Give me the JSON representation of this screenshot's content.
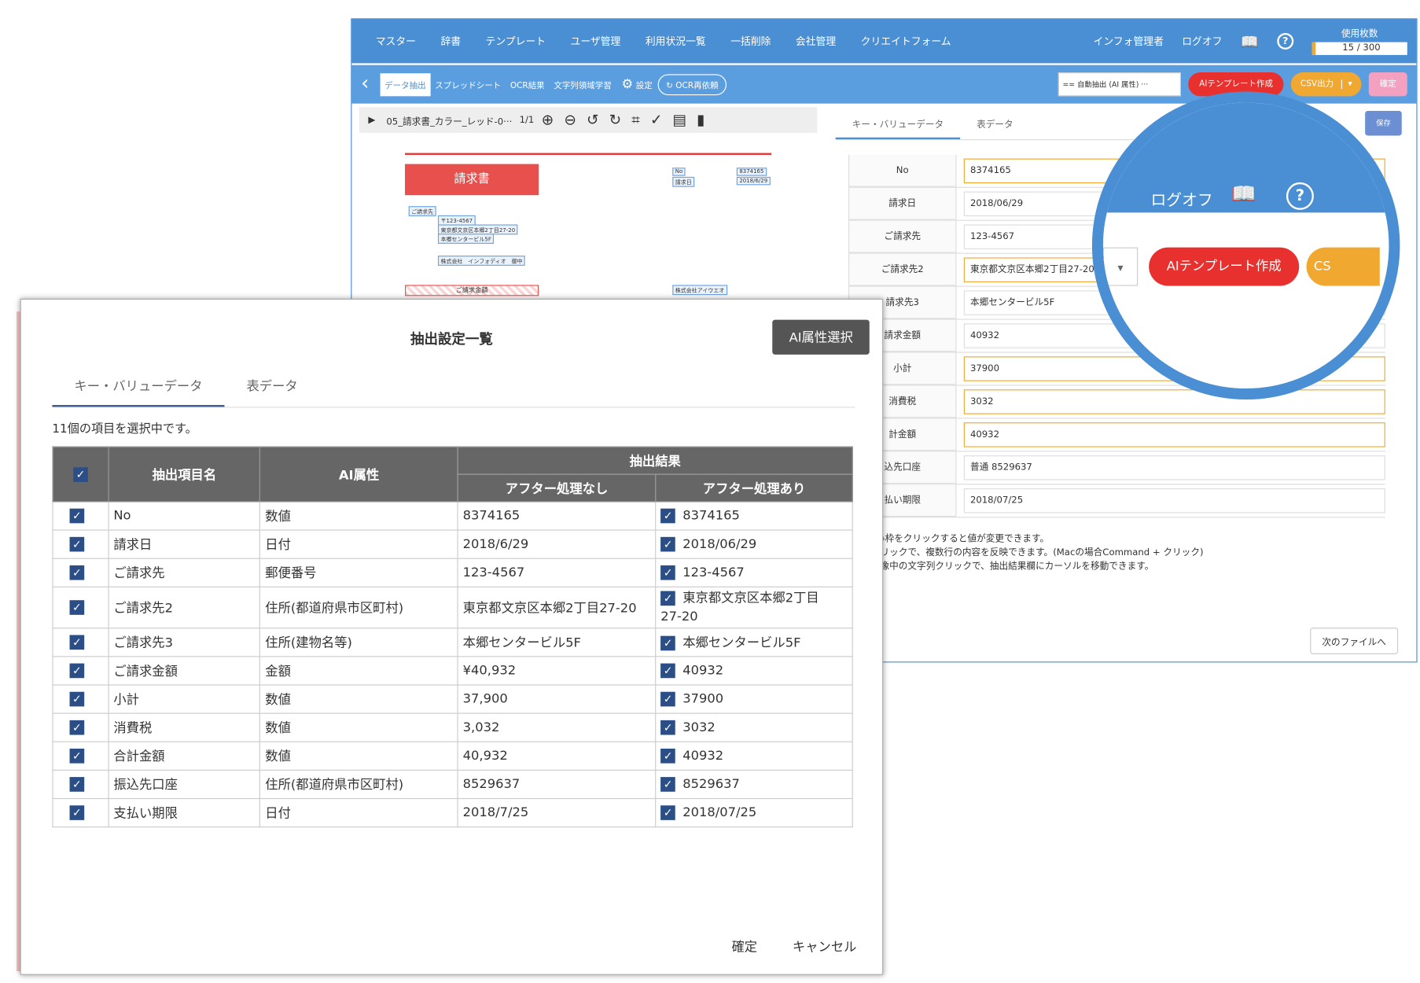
{
  "topnav": {
    "menu": [
      "マスター",
      "辞書",
      "テンプレート",
      "ユーザ管理",
      "利用状況一覧",
      "一括削除",
      "会社管理",
      "クリエイトフォーム"
    ],
    "user": "インフォ管理者",
    "logoff": "ログオフ",
    "usage_label": "使用枚数",
    "usage_value": "15 / 300"
  },
  "toolbar": {
    "tabs": [
      "データ抽出",
      "スプレッドシート",
      "OCR結果",
      "文字列領域学習"
    ],
    "settings": "設定",
    "ocr_retry": "OCR再依頼",
    "extract_select": "== 自動抽出 (AI 属性) ···",
    "ai_template": "AIテンプレート作成",
    "csv_output": "CSV出力",
    "confirm": "確定"
  },
  "document": {
    "filename": "05_請求書_カラー_レッド-0···",
    "page": "1/1",
    "pdf_title": "請求書",
    "pdf_labels": {
      "no_key": "No",
      "no_val": "8374165",
      "date_key": "請求日",
      "date_val": "2018/6/29",
      "bill_to": "ご請求先",
      "zip": "〒123-4567",
      "address": "東京都文京区本郷2丁目27-20",
      "building": "本郷センタービル5F",
      "company": "株式会社　インフォディオ　御中",
      "amount_label": "ご請求金額",
      "issuer": "株式会社アイウエオ"
    }
  },
  "right_panel": {
    "tabs": [
      "キー・バリューデータ",
      "表データ"
    ],
    "save": "保存",
    "rows": [
      {
        "key": "No",
        "value": "8374165"
      },
      {
        "key": "請求日",
        "value": "2018/06/29"
      },
      {
        "key": "ご請求先",
        "value": "123-4567"
      },
      {
        "key": "ご請求先2",
        "value": "東京都文京区本郷2丁目27-20"
      },
      {
        "key": "請求先3",
        "value": "本郷センタービル5F"
      },
      {
        "key": "請求金額",
        "value": "40932"
      },
      {
        "key": "小計",
        "value": "37900"
      },
      {
        "key": "消費税",
        "value": "3032"
      },
      {
        "key": "計金額",
        "value": "40932"
      },
      {
        "key": "込先口座",
        "value": "普通 8529637"
      },
      {
        "key": "払い期限",
        "value": "2018/07/25"
      }
    ],
    "notes": [
      "この青い枠をクリックすると値が変更できます。",
      "ー + クリックで、複数行の内容を反映できます。(Macの場合Command + クリック)",
      "ー + 画像中の文字列クリックで、抽出結果欄にカーソルを移動できます。"
    ],
    "next_file": "次のファイルへ"
  },
  "magnifier": {
    "logoff": "ログオフ",
    "ai_template": "AIテンプレート作成",
    "csv_partial": "CS"
  },
  "modal": {
    "title": "抽出設定一覧",
    "ai_attr_button": "AI属性選択",
    "tabs": [
      "キー・バリューデータ",
      "表データ"
    ],
    "selection_count": "11個の項目を選択中です。",
    "headers": {
      "item_name": "抽出項目名",
      "ai_attr": "AI属性",
      "result": "抽出結果",
      "after_none": "アフター処理なし",
      "after_yes": "アフター処理あり"
    },
    "rows": [
      {
        "name": "No",
        "attr": "数値",
        "raw": "8374165",
        "processed": "8374165"
      },
      {
        "name": "請求日",
        "attr": "日付",
        "raw": "2018/6/29",
        "processed": "2018/06/29"
      },
      {
        "name": "ご請求先",
        "attr": "郵便番号",
        "raw": "123-4567",
        "processed": "123-4567"
      },
      {
        "name": "ご請求先2",
        "attr": "住所(都道府県市区町村)",
        "raw": "東京都文京区本郷2丁目27-20",
        "processed": "東京都文京区本郷2丁目",
        "processed2": "27-20"
      },
      {
        "name": "ご請求先3",
        "attr": "住所(建物名等)",
        "raw": "本郷センタービル5F",
        "processed": "本郷センタービル5F"
      },
      {
        "name": "ご請求金額",
        "attr": "金額",
        "raw": "¥40,932",
        "processed": "40932"
      },
      {
        "name": "小計",
        "attr": "数値",
        "raw": "37,900",
        "processed": "37900"
      },
      {
        "name": "消費税",
        "attr": "数値",
        "raw": "3,032",
        "processed": "3032"
      },
      {
        "name": "合計金額",
        "attr": "数値",
        "raw": "40,932",
        "processed": "40932"
      },
      {
        "name": "振込先口座",
        "attr": "住所(都道府県市区町村)",
        "raw": "8529637",
        "processed": "8529637"
      },
      {
        "name": "支払い期限",
        "attr": "日付",
        "raw": "2018/7/25",
        "processed": "2018/07/25"
      }
    ],
    "confirm": "確定",
    "cancel": "キャンセル"
  }
}
